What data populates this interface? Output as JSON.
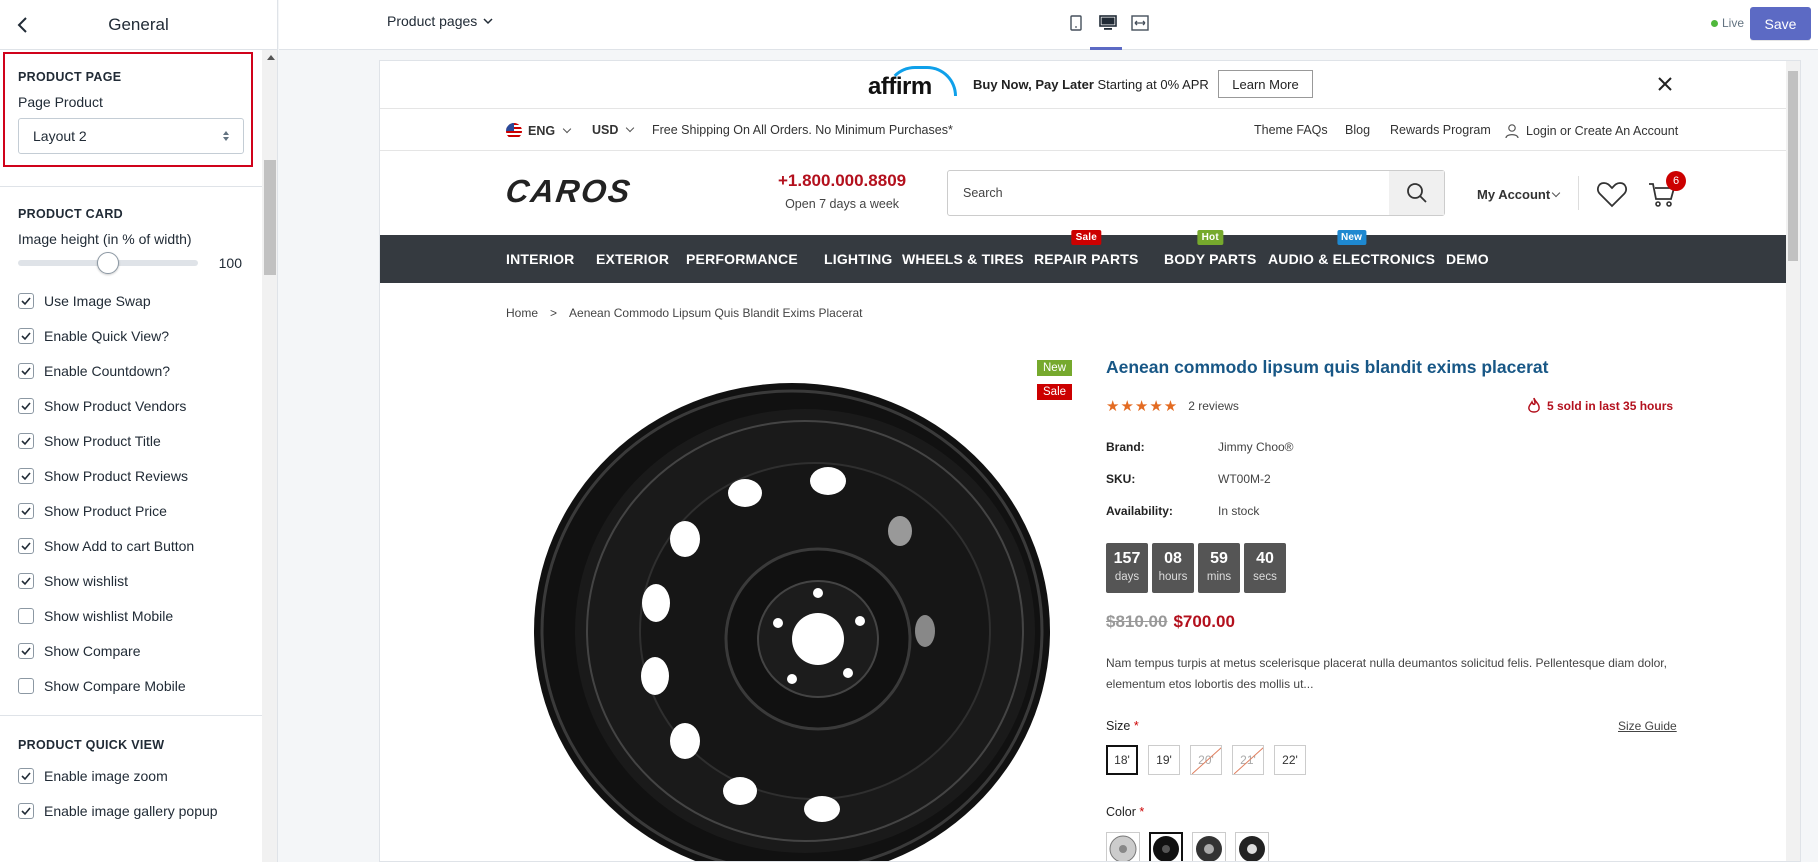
{
  "sidebar": {
    "back_icon": "chevron-left-icon",
    "title": "General",
    "product_page": {
      "heading": "PRODUCT PAGE",
      "field_label": "Page Product",
      "selected": "Layout 2"
    },
    "product_card": {
      "heading": "PRODUCT CARD",
      "image_height_label": "Image height (in % of width)",
      "image_height_value": "100",
      "image_height_percent_of_range": 50,
      "options": [
        {
          "label": "Use Image Swap",
          "checked": true
        },
        {
          "label": "Enable Quick View?",
          "checked": true
        },
        {
          "label": "Enable Countdown?",
          "checked": true
        },
        {
          "label": "Show Product Vendors",
          "checked": true
        },
        {
          "label": "Show Product Title",
          "checked": true
        },
        {
          "label": "Show Product Reviews",
          "checked": true
        },
        {
          "label": "Show Product Price",
          "checked": true
        },
        {
          "label": "Show Add to cart Button",
          "checked": true
        },
        {
          "label": "Show wishlist",
          "checked": true
        },
        {
          "label": "Show wishlist Mobile",
          "checked": false
        },
        {
          "label": "Show Compare",
          "checked": true
        },
        {
          "label": "Show Compare Mobile",
          "checked": false
        }
      ]
    },
    "product_quick_view": {
      "heading": "PRODUCT QUICK VIEW",
      "options": [
        {
          "label": "Enable image zoom",
          "checked": true
        },
        {
          "label": "Enable image gallery popup",
          "checked": true
        }
      ]
    }
  },
  "topbar": {
    "page_selector": "Product pages",
    "view_icons": [
      "mobile-icon",
      "desktop-icon",
      "full-width-icon"
    ],
    "live_label": "Live",
    "save_label": "Save",
    "accent": "#5c6ac4"
  },
  "store": {
    "affirm": {
      "logo": "affirm",
      "headline": "Buy Now, Pay Later",
      "subtext": "Starting at 0% APR",
      "button": "Learn More"
    },
    "util": {
      "language": "ENG",
      "currency": "USD",
      "shipping": "Free Shipping On All Orders. No Minimum Purchases*",
      "links": [
        "Theme FAQs",
        "Blog",
        "Rewards Program"
      ],
      "account": "Login or Create An Account"
    },
    "header": {
      "logo": "CAROS",
      "phone": "+1.800.000.8809",
      "hours": "Open 7 days a week",
      "search_placeholder": "Search",
      "my_account": "My Account",
      "cart_count": "6"
    },
    "nav": [
      {
        "label": "INTERIOR",
        "badge": null
      },
      {
        "label": "EXTERIOR",
        "badge": null
      },
      {
        "label": "PERFORMANCE",
        "badge": null
      },
      {
        "label": "LIGHTING",
        "badge": null
      },
      {
        "label": "WHEELS & TIRES",
        "badge": null
      },
      {
        "label": "REPAIR PARTS",
        "badge": "Sale",
        "badge_color": "#c00"
      },
      {
        "label": "BODY PARTS",
        "badge": "Hot",
        "badge_color": "#76a92d"
      },
      {
        "label": "AUDIO & ELECTRONICS",
        "badge": "New",
        "badge_color": "#1e88d0"
      },
      {
        "label": "DEMO",
        "badge": null
      }
    ],
    "breadcrumb": {
      "home": "Home",
      "separator": ">",
      "current": "Aenean Commodo Lipsum Quis Blandit Exims Placerat"
    },
    "product": {
      "badge_new": "New",
      "badge_sale": "Sale",
      "title": "Aenean commodo lipsum quis blandit exims placerat",
      "stars": "★★★★★",
      "reviews": "2 reviews",
      "sold": "5 sold in last 35 hours",
      "brand_label": "Brand:",
      "brand": "Jimmy Choo®",
      "sku_label": "SKU:",
      "sku": "WT00M-2",
      "availability_label": "Availability:",
      "availability": "In stock",
      "countdown": [
        {
          "n": "157",
          "l": "days"
        },
        {
          "n": "08",
          "l": "hours"
        },
        {
          "n": "59",
          "l": "mins"
        },
        {
          "n": "40",
          "l": "secs"
        }
      ],
      "price_old": "$810.00",
      "price_new": "$700.00",
      "description": "Nam tempus turpis at metus scelerisque placerat nulla deumantos solicitud felis. Pellentesque diam dolor, elementum etos lobortis des mollis ut...",
      "size_label": "Size",
      "size_guide": "Size Guide",
      "sizes": [
        {
          "label": "18'",
          "state": "active"
        },
        {
          "label": "19'",
          "state": "normal"
        },
        {
          "label": "20'",
          "state": "disabled"
        },
        {
          "label": "21'",
          "state": "disabled"
        },
        {
          "label": "22'",
          "state": "normal"
        }
      ],
      "color_label": "Color",
      "required_mark": "*"
    }
  }
}
